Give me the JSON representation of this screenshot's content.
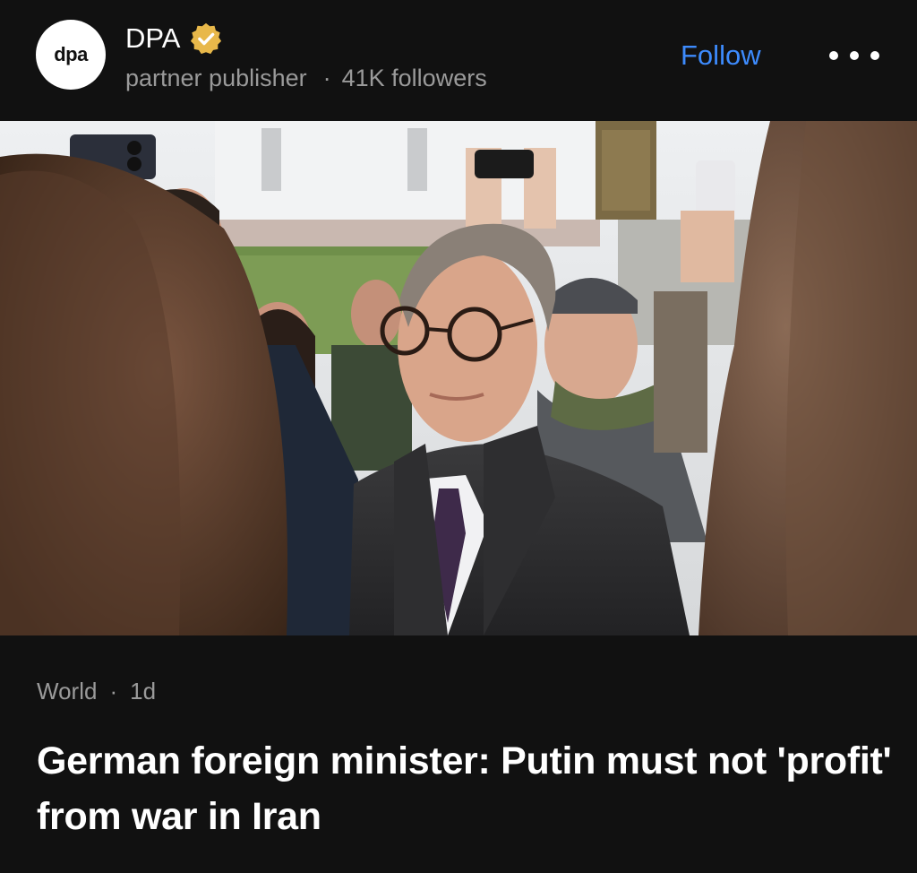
{
  "publisher": {
    "avatar_text": "dpa",
    "name": "DPA",
    "verified_icon": "verified-badge-icon",
    "subtitle": "partner publisher",
    "separator": "·",
    "followers": "41K followers"
  },
  "actions": {
    "follow_label": "Follow",
    "more_icon": "more-dots-icon"
  },
  "article": {
    "category": "World",
    "separator": "·",
    "age": "1d",
    "headline": "German foreign minister: Putin must not 'profit' from war in Iran"
  },
  "colors": {
    "background": "#111111",
    "accent": "#3d8bfd",
    "verified_badge": "#e8b84a",
    "muted_text": "#9a9a9a"
  }
}
